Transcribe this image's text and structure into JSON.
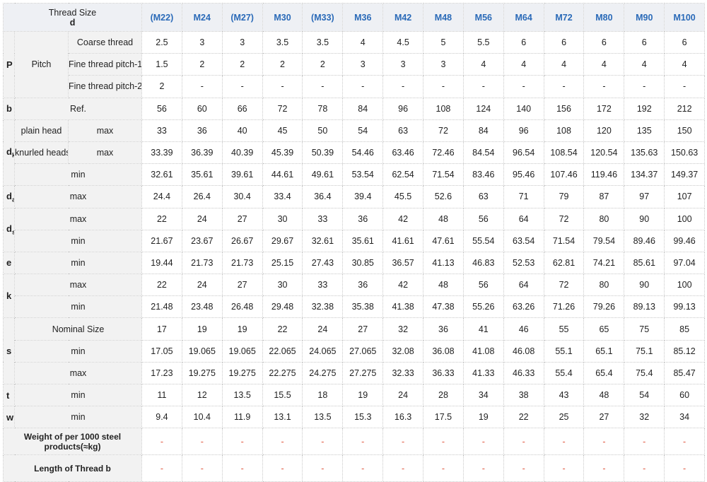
{
  "header": {
    "thread_size": "Thread Size",
    "d": "d",
    "sizes": [
      "(M22)",
      "M24",
      "(M27)",
      "M30",
      "(M33)",
      "M36",
      "M42",
      "M48",
      "M56",
      "M64",
      "M72",
      "M80",
      "M90",
      "M100"
    ]
  },
  "labels": {
    "P": "P",
    "pitch": "Pitch",
    "coarse": "Coarse thread",
    "fine1": "Fine thread pitch-1",
    "fine2": "Fine thread pitch-2",
    "b": "b",
    "ref": "Ref.",
    "dk": "d",
    "dk_sub": "k",
    "plain_head": "plain head",
    "knurled_heads": "knurled heads",
    "max": "max",
    "min": "min",
    "da": "d",
    "da_sub": "a",
    "ds": "d",
    "ds_sub": "s",
    "e": "e",
    "k": "k",
    "s": "s",
    "nominal_size": "Nominal Size",
    "t": "t",
    "w": "w",
    "weight": "Weight of per 1000 steel products(≈kg)",
    "length": "Length of Thread b"
  },
  "rows": {
    "coarse": [
      "2.5",
      "3",
      "3",
      "3.5",
      "3.5",
      "4",
      "4.5",
      "5",
      "5.5",
      "6",
      "6",
      "6",
      "6",
      "6"
    ],
    "fine1": [
      "1.5",
      "2",
      "2",
      "2",
      "2",
      "3",
      "3",
      "3",
      "4",
      "4",
      "4",
      "4",
      "4",
      "4"
    ],
    "fine2": [
      "2",
      "-",
      "-",
      "-",
      "-",
      "-",
      "-",
      "-",
      "-",
      "-",
      "-",
      "-",
      "-",
      "-"
    ],
    "b_ref": [
      "56",
      "60",
      "66",
      "72",
      "78",
      "84",
      "96",
      "108",
      "124",
      "140",
      "156",
      "172",
      "192",
      "212"
    ],
    "dk_plain_max": [
      "33",
      "36",
      "40",
      "45",
      "50",
      "54",
      "63",
      "72",
      "84",
      "96",
      "108",
      "120",
      "135",
      "150"
    ],
    "dk_knurled_max": [
      "33.39",
      "36.39",
      "40.39",
      "45.39",
      "50.39",
      "54.46",
      "63.46",
      "72.46",
      "84.54",
      "96.54",
      "108.54",
      "120.54",
      "135.63",
      "150.63"
    ],
    "dk_min": [
      "32.61",
      "35.61",
      "39.61",
      "44.61",
      "49.61",
      "53.54",
      "62.54",
      "71.54",
      "83.46",
      "95.46",
      "107.46",
      "119.46",
      "134.37",
      "149.37"
    ],
    "da_max": [
      "24.4",
      "26.4",
      "30.4",
      "33.4",
      "36.4",
      "39.4",
      "45.5",
      "52.6",
      "63",
      "71",
      "79",
      "87",
      "97",
      "107"
    ],
    "ds_max": [
      "22",
      "24",
      "27",
      "30",
      "33",
      "36",
      "42",
      "48",
      "56",
      "64",
      "72",
      "80",
      "90",
      "100"
    ],
    "ds_min": [
      "21.67",
      "23.67",
      "26.67",
      "29.67",
      "32.61",
      "35.61",
      "41.61",
      "47.61",
      "55.54",
      "63.54",
      "71.54",
      "79.54",
      "89.46",
      "99.46"
    ],
    "e_min": [
      "19.44",
      "21.73",
      "21.73",
      "25.15",
      "27.43",
      "30.85",
      "36.57",
      "41.13",
      "46.83",
      "52.53",
      "62.81",
      "74.21",
      "85.61",
      "97.04"
    ],
    "k_max": [
      "22",
      "24",
      "27",
      "30",
      "33",
      "36",
      "42",
      "48",
      "56",
      "64",
      "72",
      "80",
      "90",
      "100"
    ],
    "k_min": [
      "21.48",
      "23.48",
      "26.48",
      "29.48",
      "32.38",
      "35.38",
      "41.38",
      "47.38",
      "55.26",
      "63.26",
      "71.26",
      "79.26",
      "89.13",
      "99.13"
    ],
    "s_nominal": [
      "17",
      "19",
      "19",
      "22",
      "24",
      "27",
      "32",
      "36",
      "41",
      "46",
      "55",
      "65",
      "75",
      "85"
    ],
    "s_min": [
      "17.05",
      "19.065",
      "19.065",
      "22.065",
      "24.065",
      "27.065",
      "32.08",
      "36.08",
      "41.08",
      "46.08",
      "55.1",
      "65.1",
      "75.1",
      "85.12"
    ],
    "s_max": [
      "17.23",
      "19.275",
      "19.275",
      "22.275",
      "24.275",
      "27.275",
      "32.33",
      "36.33",
      "41.33",
      "46.33",
      "55.4",
      "65.4",
      "75.4",
      "85.47"
    ],
    "t_min": [
      "11",
      "12",
      "13.5",
      "15.5",
      "18",
      "19",
      "24",
      "28",
      "34",
      "38",
      "43",
      "48",
      "54",
      "60"
    ],
    "w_min": [
      "9.4",
      "10.4",
      "11.9",
      "13.1",
      "13.5",
      "15.3",
      "16.3",
      "17.5",
      "19",
      "22",
      "25",
      "27",
      "32",
      "34"
    ],
    "weight": [
      "-",
      "-",
      "-",
      "-",
      "-",
      "-",
      "-",
      "-",
      "-",
      "-",
      "-",
      "-",
      "-",
      "-"
    ],
    "length": [
      "-",
      "-",
      "-",
      "-",
      "-",
      "-",
      "-",
      "-",
      "-",
      "-",
      "-",
      "-",
      "-",
      "-"
    ]
  },
  "colors": {
    "header_text": "#2a6ab8",
    "dash": "#e0533a",
    "label_bg": "#f2f2f2"
  }
}
